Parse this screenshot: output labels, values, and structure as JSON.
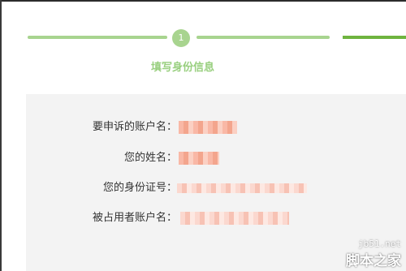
{
  "step": {
    "number": "1",
    "title": "填写身份信息"
  },
  "form": {
    "fields": [
      {
        "label": "要申诉的账户名："
      },
      {
        "label": "您的姓名："
      },
      {
        "label": "您的身份证号："
      },
      {
        "label": "被占用者账户名："
      }
    ]
  },
  "watermark": {
    "url": "jb51.net",
    "name": "脚本之家"
  },
  "colors": {
    "step_inactive": "#a8d48f",
    "step_active": "#6fb43f",
    "title": "#98cf7e",
    "panel_bg": "#f3f3f3"
  }
}
